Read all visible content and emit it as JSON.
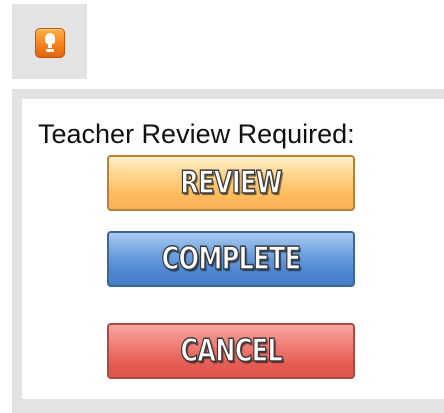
{
  "alert": {
    "icon": "alert-icon"
  },
  "panel": {
    "title": "Teacher Review Required:",
    "buttons": {
      "review": "REVIEW",
      "complete": "COMPLETE",
      "cancel": "CANCEL"
    }
  },
  "colors": {
    "review": "#fdbd5e",
    "complete": "#4d85cf",
    "cancel": "#e45c54",
    "alert": "#f5821e",
    "panel_border": "#e3e3e3"
  }
}
